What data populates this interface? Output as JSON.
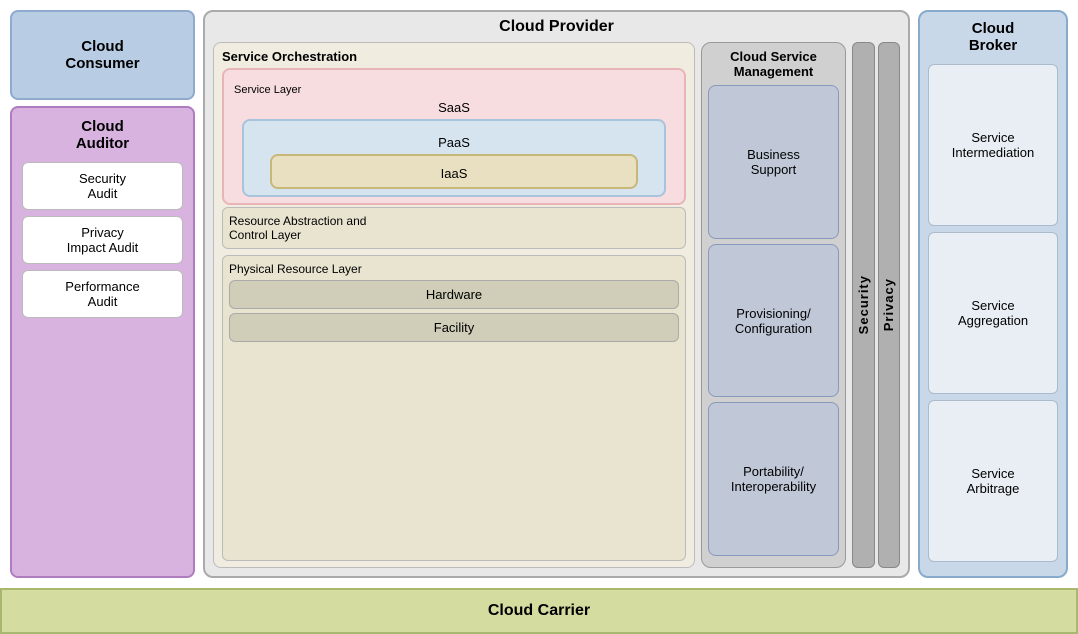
{
  "cloudConsumer": {
    "title": "Cloud\nConsumer"
  },
  "cloudAuditor": {
    "title": "Cloud\nAuditor",
    "items": [
      {
        "label": "Security\nAudit"
      },
      {
        "label": "Privacy\nImpact Audit"
      },
      {
        "label": "Performance\nAudit"
      }
    ]
  },
  "cloudProvider": {
    "title": "Cloud Provider",
    "serviceOrchestration": {
      "title": "Service Orchestration",
      "serviceLayer": {
        "label": "Service Layer",
        "saas": "SaaS",
        "paas": "PaaS",
        "iaas": "IaaS"
      },
      "resourceAbstractionLayer": "Resource Abstraction and\nControl Layer",
      "physicalResourceLayer": {
        "title": "Physical Resource Layer",
        "hardware": "Hardware",
        "facility": "Facility"
      }
    },
    "cloudServiceManagement": {
      "title": "Cloud Service\nManagement",
      "items": [
        "Business\nSupport",
        "Provisioning/\nConfiguration",
        "Portability/\nInteroperability"
      ]
    },
    "security": "Security",
    "privacy": "Privacy"
  },
  "cloudBroker": {
    "title": "Cloud\nBroker",
    "items": [
      "Service\nIntermediation",
      "Service\nAggregation",
      "Service\nArbitrage"
    ]
  },
  "cloudCarrier": {
    "title": "Cloud Carrier"
  }
}
